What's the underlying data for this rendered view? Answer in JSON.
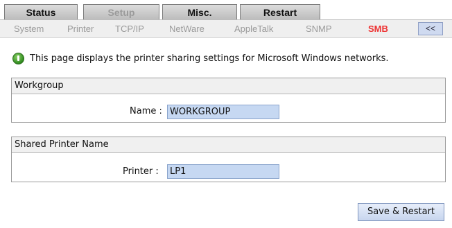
{
  "tabs": {
    "status": "Status",
    "setup": "Setup",
    "misc": "Misc.",
    "restart": "Restart"
  },
  "subnav": {
    "system": "System",
    "printer": "Printer",
    "tcpip": "TCP/IP",
    "netware": "NetWare",
    "appletalk": "AppleTalk",
    "snmp": "SNMP",
    "smb": "SMB",
    "collapse": "<<"
  },
  "info": {
    "icon": "info-icon",
    "text": "This page displays the printer sharing settings for Microsoft Windows networks."
  },
  "workgroup": {
    "title": "Workgroup",
    "label": "Name :",
    "value": "WORKGROUP"
  },
  "shared_printer": {
    "title": "Shared Printer Name",
    "label": "Printer :",
    "value": "LP1"
  },
  "actions": {
    "save_restart": "Save & Restart"
  },
  "colors": {
    "active_subnav": "#ee3333",
    "input_bg": "#c6d8f2"
  }
}
